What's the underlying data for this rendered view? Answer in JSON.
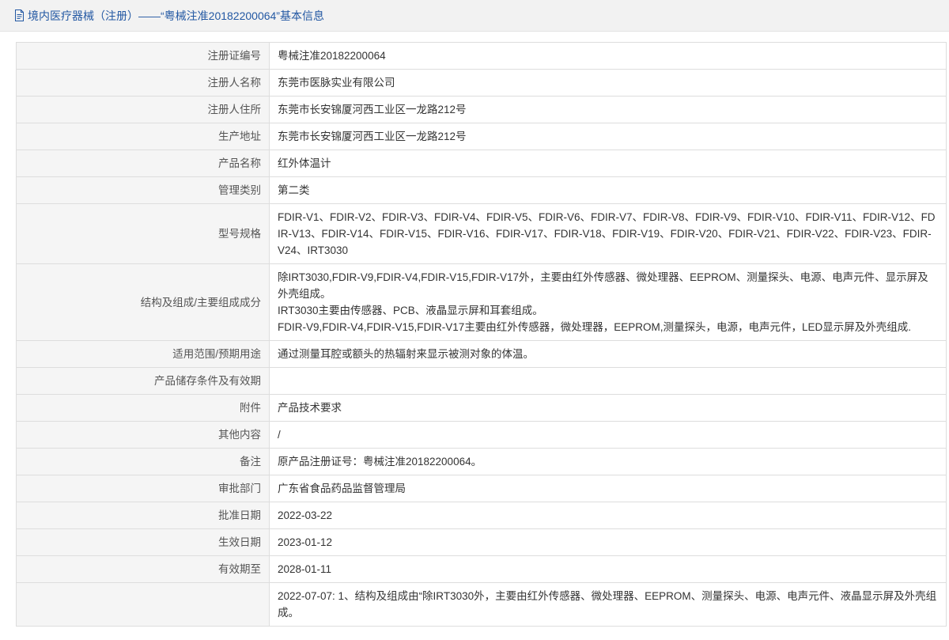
{
  "colors": {
    "title": "#2358a3",
    "label_bg": "#f5f5f5",
    "border": "#dddddd"
  },
  "header": {
    "icon": "document-icon",
    "title": "境内医疗器械（注册）——“粤械注准20182200064”基本信息"
  },
  "rows": [
    {
      "label": "注册证编号",
      "value": "粤械注准20182200064"
    },
    {
      "label": "注册人名称",
      "value": "东莞市医脉实业有限公司"
    },
    {
      "label": "注册人住所",
      "value": "东莞市长安锦厦河西工业区一龙路212号"
    },
    {
      "label": "生产地址",
      "value": "东莞市长安锦厦河西工业区一龙路212号"
    },
    {
      "label": "产品名称",
      "value": "红外体温计"
    },
    {
      "label": "管理类别",
      "value": "第二类"
    },
    {
      "label": "型号规格",
      "value": "FDIR-V1、FDIR-V2、FDIR-V3、FDIR-V4、FDIR-V5、FDIR-V6、FDIR-V7、FDIR-V8、FDIR-V9、FDIR-V10、FDIR-V11、FDIR-V12、FDIR-V13、FDIR-V14、FDIR-V15、FDIR-V16、FDIR-V17、FDIR-V18、FDIR-V19、FDIR-V20、FDIR-V21、FDIR-V22、FDIR-V23、FDIR-V24、IRT3030"
    },
    {
      "label": "结构及组成/主要组成成分",
      "value": "除IRT3030,FDIR-V9,FDIR-V4,FDIR-V15,FDIR-V17外，主要由红外传感器、微处理器、EEPROM、测量探头、电源、电声元件、显示屏及外壳组成。\nIRT3030主要由传感器、PCB、液晶显示屏和耳套组成。\nFDIR-V9,FDIR-V4,FDIR-V15,FDIR-V17主要由红外传感器，微处理器，EEPROM,测量探头，电源，电声元件，LED显示屏及外壳组成."
    },
    {
      "label": "适用范围/预期用途",
      "value": "通过测量耳腔或额头的热辐射来显示被测对象的体温。"
    },
    {
      "label": "产品储存条件及有效期",
      "value": ""
    },
    {
      "label": "附件",
      "value": "产品技术要求"
    },
    {
      "label": "其他内容",
      "value": "/"
    },
    {
      "label": "备注",
      "value": "原产品注册证号：粤械注准20182200064。"
    },
    {
      "label": "审批部门",
      "value": "广东省食品药品监督管理局"
    },
    {
      "label": "批准日期",
      "value": "2022-03-22"
    },
    {
      "label": "生效日期",
      "value": "2023-01-12"
    },
    {
      "label": "有效期至",
      "value": "2028-01-11"
    },
    {
      "label": "",
      "value": "2022-07-07: 1、结构及组成由“除IRT3030外，主要由红外传感器、微处理器、EEPROM、测量探头、电源、电声元件、液晶显示屏及外壳组成。"
    }
  ]
}
